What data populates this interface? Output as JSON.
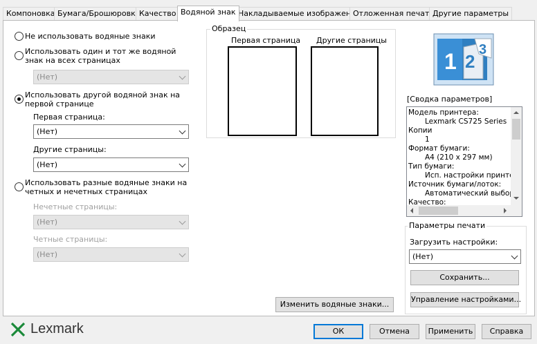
{
  "tabs": [
    {
      "label": "Компоновка"
    },
    {
      "label": "Бумага/Брошюровка"
    },
    {
      "label": "Качество"
    },
    {
      "label": "Водяной знак"
    },
    {
      "label": "Накладываемые изображения"
    },
    {
      "label": "Отложенная печать"
    },
    {
      "label": "Другие параметры"
    }
  ],
  "watermark": {
    "opt_none": "Не использовать водяные знаки",
    "opt_same": "Использовать один и тот же водяной знак на всех страницах",
    "opt_same_select": "(Нет)",
    "opt_first": "Использовать другой водяной знак на первой странице",
    "first_page_label": "Первая страница:",
    "first_page_select": "(Нет)",
    "other_pages_label": "Другие страницы:",
    "other_pages_select": "(Нет)",
    "opt_oddeven": "Использовать разные водяные знаки на четных и нечетных страницах",
    "odd_label": "Нечетные страницы:",
    "odd_select": "(Нет)",
    "even_label": "Четные страницы:",
    "even_select": "(Нет)",
    "selected_option": "opt_first"
  },
  "preview": {
    "title": "Образец",
    "first_page": "Первая страница",
    "other_pages": "Другие страницы"
  },
  "summary": {
    "title": "[Сводка параметров]",
    "lines": [
      "Модель принтера:",
      "Lexmark CS725 Series",
      "Копии",
      "1",
      "Формат бумаги:",
      "A4 (210 x 297 мм)",
      "Тип бумаги:",
      "Исп. настройки принтера",
      "Источник бумаги/лоток:",
      "Автоматический выбор",
      "Качество:"
    ]
  },
  "print_settings": {
    "title": "Параметры печати",
    "load_label": "Загрузить настройки:",
    "load_select": "(Нет)",
    "save_button": "Сохранить...",
    "manage_button": "Управление настройками..."
  },
  "edit_watermarks_button": "Изменить водяные знаки...",
  "footer": {
    "brand": "Lexmark",
    "ok": "ОК",
    "cancel": "Отмена",
    "apply": "Применить",
    "help": "Справка"
  },
  "colors": {
    "accent": "#0078d7",
    "logo_green": "#1b8a3a",
    "icon_blue": "#2f7fc1"
  }
}
